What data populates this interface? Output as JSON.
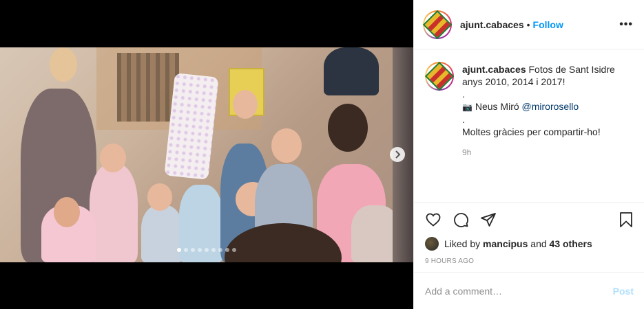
{
  "header": {
    "username": "ajunt.cabaces",
    "separator": "•",
    "follow_label": "Follow",
    "more_label": "•••"
  },
  "caption": {
    "username": "ajunt.cabaces",
    "text_line1": "Fotos de Sant Isidre",
    "text_line2": "anys 2010, 2014 i 2017!",
    "dot1": ".",
    "camera_emoji": "📷",
    "credit_name": "Neus Miró",
    "credit_handle": "@mirorosello",
    "dot2": ".",
    "thanks": "Moltes gràcies per compartir-ho!",
    "time": "9h"
  },
  "carousel": {
    "total": 9,
    "active_index": 0,
    "icons": {
      "next": "chevron-right-icon"
    }
  },
  "actions": {
    "icons": [
      "heart-icon",
      "comment-icon",
      "share-icon",
      "bookmark-icon"
    ]
  },
  "likes": {
    "prefix": "Liked by",
    "user": "mancipus",
    "and": "and",
    "others": "43 others"
  },
  "timestamp": "9 HOURS AGO",
  "comment": {
    "placeholder": "Add a comment…",
    "post_label": "Post"
  },
  "colors": {
    "link_blue": "#0095f6",
    "post_disabled": "#b2dffc",
    "mention": "#00376b",
    "muted": "#8e8e8e"
  }
}
